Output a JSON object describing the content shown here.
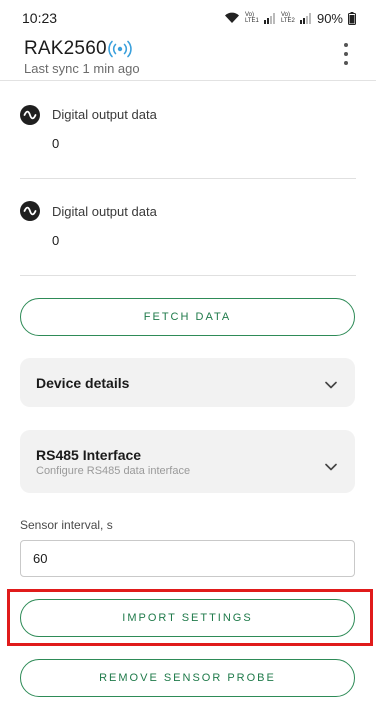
{
  "status_bar": {
    "time": "10:23",
    "battery": "90%",
    "sim1_label": "Vo) LTE1",
    "sim2_label": "Vo) LTE2",
    "icons": [
      "wifi-icon",
      "signal-icon",
      "battery-icon"
    ]
  },
  "header": {
    "title": "RAK2560",
    "sync_text": "Last sync 1 min ago",
    "icons": [
      "radio-waves-icon",
      "more-vert-icon"
    ],
    "accent_color": "#3aa0dc"
  },
  "data_rows": [
    {
      "label": "Digital output data",
      "value": "0",
      "icon": "waveform-icon"
    },
    {
      "label": "Digital output data",
      "value": "0",
      "icon": "waveform-icon"
    }
  ],
  "buttons": {
    "fetch_data": "FETCH DATA",
    "import_settings": "IMPORT SETTINGS",
    "remove_probe": "REMOVE SENSOR PROBE",
    "color": "#2e8b57"
  },
  "cards": {
    "device_details": {
      "title": "Device details"
    },
    "rs485": {
      "title": "RS485 Interface",
      "subtitle": "Configure RS485 data interface"
    }
  },
  "sensor_interval": {
    "label": "Sensor interval, s",
    "value": "60"
  },
  "highlight_color": "#e01b1b"
}
